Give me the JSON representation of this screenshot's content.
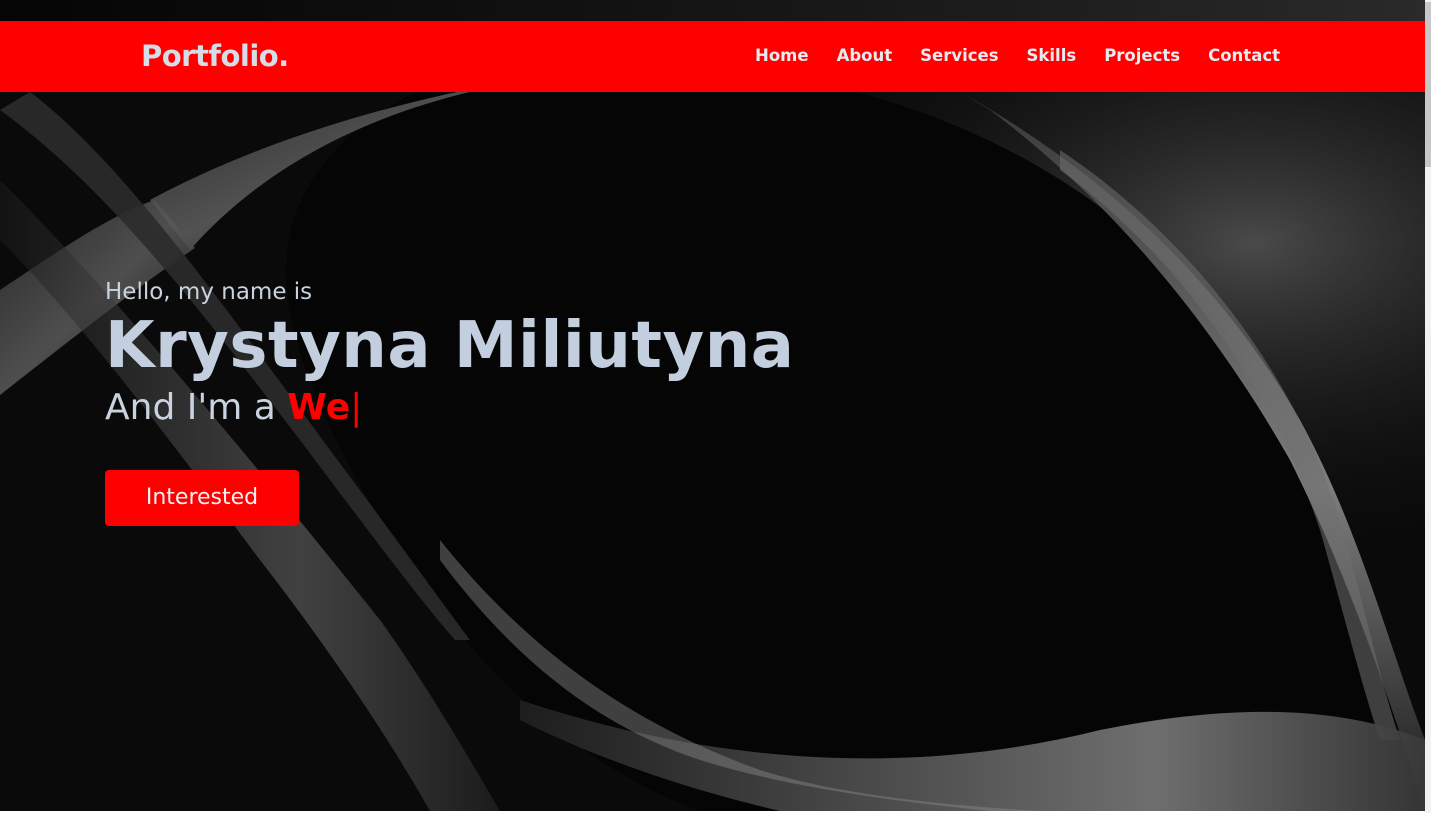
{
  "navbar": {
    "logo": "Portfolio.",
    "links": [
      {
        "label": "Home"
      },
      {
        "label": "About"
      },
      {
        "label": "Services"
      },
      {
        "label": "Skills"
      },
      {
        "label": "Projects"
      },
      {
        "label": "Contact"
      }
    ],
    "background_color": "#ff0000"
  },
  "hero": {
    "greeting": "Hello, my name is",
    "name": "Krystyna Miliutyna",
    "role_prefix": "And I'm a",
    "role_typed": "We",
    "cursor": "|",
    "cta_label": "Interested"
  },
  "colors": {
    "accent": "#ff0000",
    "text_light": "#c3cfdf",
    "background": "#0b0b0b"
  }
}
